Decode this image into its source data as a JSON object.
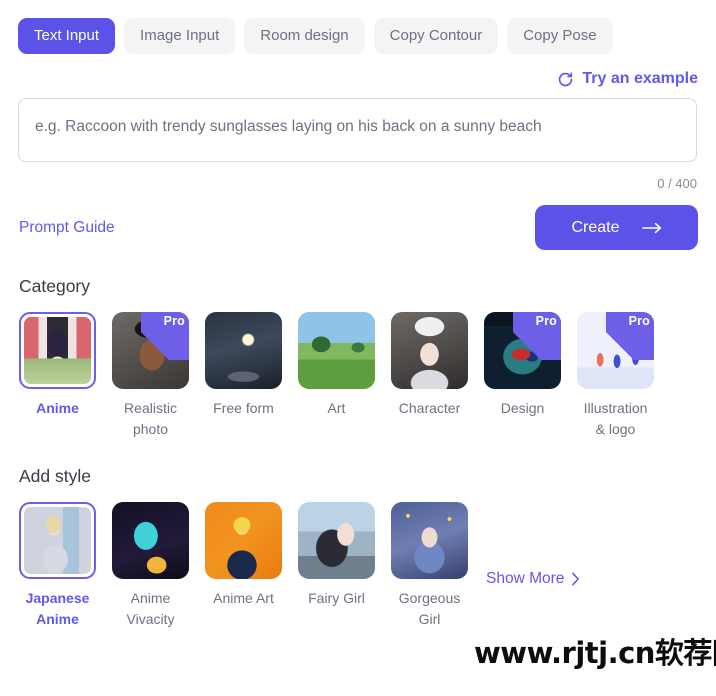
{
  "theme": {
    "accent": "#5d52e8",
    "accent_text": "#6259e8",
    "tab_inactive_bg": "#f4f4f5",
    "muted_text": "#6b7280"
  },
  "tabs": [
    {
      "label": "Text Input",
      "active": true
    },
    {
      "label": "Image Input",
      "active": false
    },
    {
      "label": "Room design",
      "active": false
    },
    {
      "label": "Copy Contour",
      "active": false
    },
    {
      "label": "Copy Pose",
      "active": false
    }
  ],
  "example": {
    "label": "Try an example",
    "icon": "refresh-icon"
  },
  "prompt": {
    "value": "",
    "placeholder": "e.g. Raccoon with trendy sunglasses laying on his back on a sunny beach",
    "counter": "0 / 400",
    "max_length": 400
  },
  "actions": {
    "guide_label": "Prompt Guide",
    "create_label": "Create",
    "create_icon": "arrow-right-icon"
  },
  "category": {
    "title": "Category",
    "items": [
      {
        "label": "Anime",
        "selected": true,
        "pro": false
      },
      {
        "label": "Realistic photo",
        "selected": false,
        "pro": true
      },
      {
        "label": "Free form",
        "selected": false,
        "pro": false
      },
      {
        "label": "Art",
        "selected": false,
        "pro": false
      },
      {
        "label": "Character",
        "selected": false,
        "pro": false
      },
      {
        "label": "Design",
        "selected": false,
        "pro": true
      },
      {
        "label": "Illustration & logo",
        "selected": false,
        "pro": true
      }
    ],
    "pro_badge_label": "Pro"
  },
  "style": {
    "title": "Add style",
    "items": [
      {
        "label": "Japanese Anime",
        "selected": true,
        "pro": false
      },
      {
        "label": "Anime Vivacity",
        "selected": false,
        "pro": false
      },
      {
        "label": "Anime Art",
        "selected": false,
        "pro": false
      },
      {
        "label": "Fairy Girl",
        "selected": false,
        "pro": false
      },
      {
        "label": "Gorgeous Girl",
        "selected": false,
        "pro": false
      }
    ],
    "show_more_label": "Show More",
    "show_more_icon": "chevron-right-icon"
  },
  "watermark": {
    "text": "www.rjtj.cn软荐网"
  }
}
